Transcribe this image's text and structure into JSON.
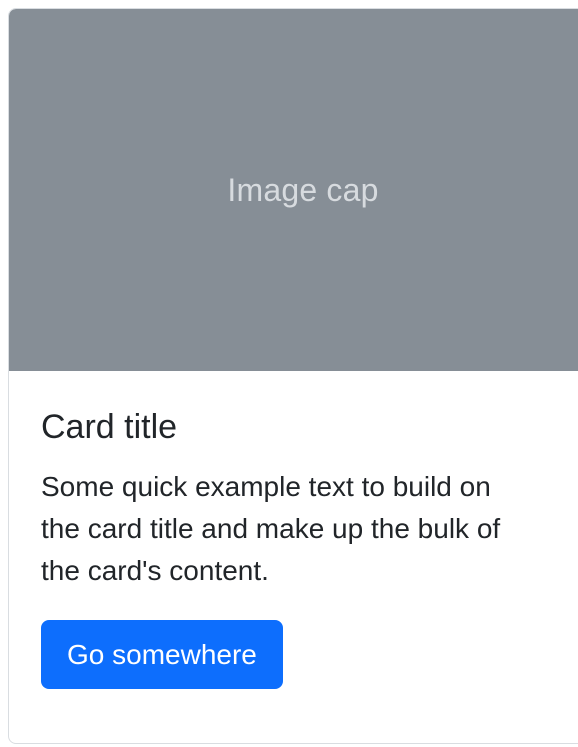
{
  "card": {
    "image_cap": "Image cap",
    "title": "Card title",
    "text": "Some quick example text to build on the card title and make up the bulk of the card's content.",
    "button_label": "Go somewhere"
  },
  "colors": {
    "image_bg": "#868e96",
    "image_text": "#d7dbdf",
    "button_bg": "#0d6efd",
    "text": "#212529"
  }
}
